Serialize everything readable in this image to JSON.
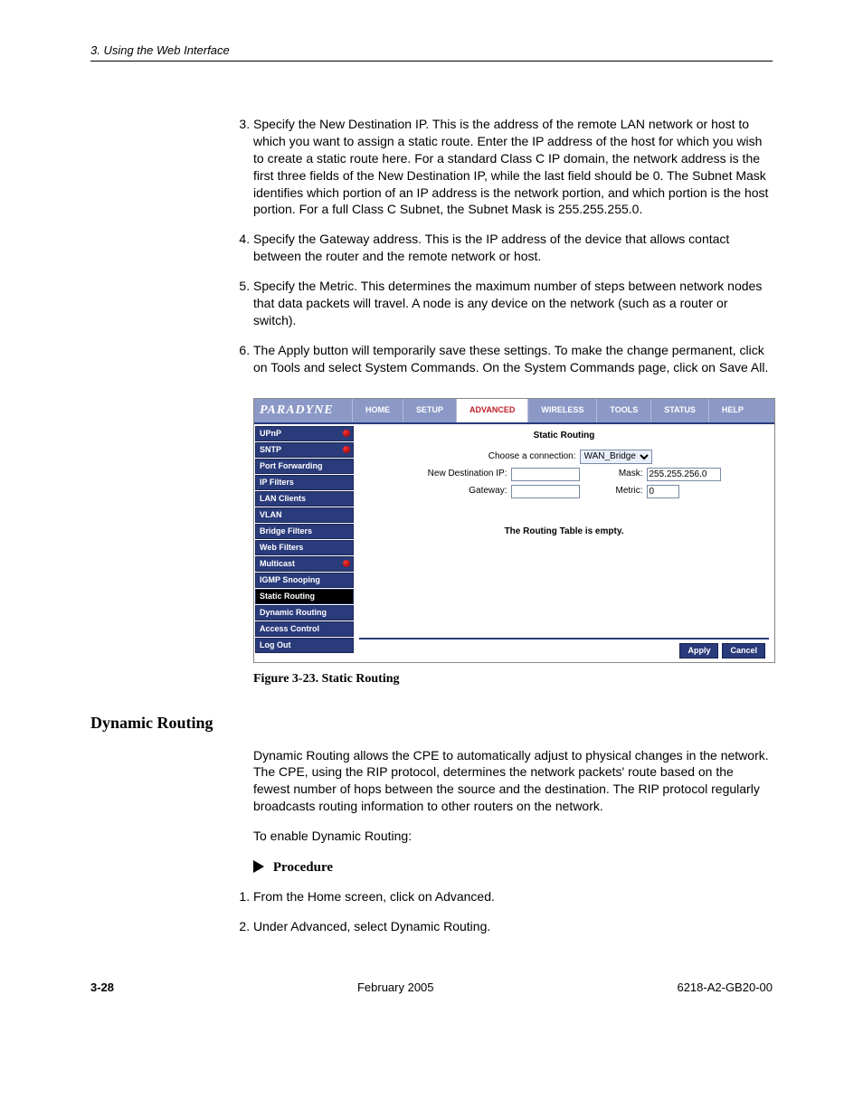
{
  "header": "3. Using the Web Interface",
  "steps_top": [
    "Specify the New Destination IP. This is the address of the remote LAN network or host to which you want to assign a static route. Enter the IP address of the host for which you wish to create a static route here. For a standard Class C IP domain, the network address is the first three fields of the New Destination IP, while the last field should be 0. The Subnet Mask identifies which portion of an IP address is the network portion, and which portion is the host portion. For a full Class C Subnet, the Subnet Mask is 255.255.255.0.",
    "Specify the Gateway address. This is the IP address of the device that allows contact between the router and the remote network or host.",
    "Specify the Metric. This determines the maximum number of steps between network nodes that data packets will travel. A node is any device on the network (such as a router or switch).",
    "The Apply button will temporarily save these settings. To make the change permanent, click on Tools and select System Commands. On the System Commands page, click on Save All."
  ],
  "figure_caption": "Figure 3-23.   Static Routing",
  "section_title": "Dynamic Routing",
  "dyn_para": "Dynamic Routing allows the CPE to automatically adjust to physical changes in the network. The CPE, using the RIP protocol, determines the network packets' route based on the fewest number of hops between the source and the destination. The RIP protocol regularly broadcasts routing information to other routers on the network.",
  "dyn_intro": "To enable Dynamic Routing:",
  "procedure_label": "Procedure",
  "proc_steps": [
    "From the Home screen, click on Advanced.",
    "Under Advanced, select Dynamic Routing."
  ],
  "footer": {
    "page": "3-28",
    "date": "February 2005",
    "docid": "6218-A2-GB20-00"
  },
  "router": {
    "brand": "PARADYNE",
    "tabs": [
      "HOME",
      "SETUP",
      "ADVANCED",
      "WIRELESS",
      "TOOLS",
      "STATUS",
      "HELP"
    ],
    "active_tab_index": 2,
    "sidebar": [
      {
        "label": "UPnP",
        "dot": true
      },
      {
        "label": "SNTP",
        "dot": true
      },
      {
        "label": "Port Forwarding"
      },
      {
        "label": "IP Filters"
      },
      {
        "label": "LAN Clients"
      },
      {
        "label": "VLAN"
      },
      {
        "label": "Bridge Filters"
      },
      {
        "label": "Web Filters"
      },
      {
        "label": "Multicast",
        "dot": true
      },
      {
        "label": "IGMP Snooping"
      },
      {
        "label": "Static Routing",
        "selected": true
      },
      {
        "label": "Dynamic Routing"
      },
      {
        "label": "Access Control"
      },
      {
        "label": "Log Out"
      }
    ],
    "content": {
      "title": "Static Routing",
      "choose_label": "Choose a connection:",
      "choose_value": "WAN_Bridge",
      "new_dest_label": "New Destination IP:",
      "new_dest_value": "",
      "mask_label": "Mask:",
      "mask_value": "255.255.256.0",
      "gateway_label": "Gateway:",
      "gateway_value": "",
      "metric_label": "Metric:",
      "metric_value": "0",
      "empty": "The Routing Table is empty.",
      "apply": "Apply",
      "cancel": "Cancel"
    }
  }
}
